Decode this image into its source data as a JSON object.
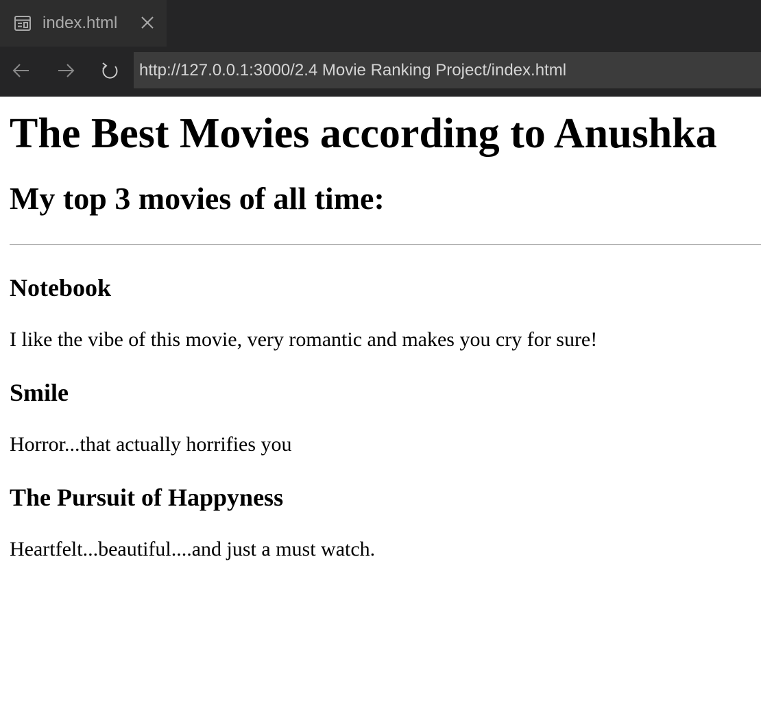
{
  "browser": {
    "tab": {
      "title": "index.html",
      "icon": "preview-icon",
      "close_icon": "close-icon"
    },
    "nav": {
      "back_icon": "back-arrow-icon",
      "forward_icon": "forward-arrow-icon",
      "reload_icon": "reload-icon",
      "url": "http://127.0.0.1:3000/2.4 Movie Ranking Project/index.html"
    },
    "colors": {
      "chrome_background": "#252526",
      "tab_background": "#2d2d2d",
      "url_background": "#3c3c3c"
    }
  },
  "page": {
    "title": "The Best Movies according to Anushka",
    "subtitle": "My top 3 movies of all time:",
    "movies": [
      {
        "title": "Notebook",
        "description": "I like the vibe of this movie, very romantic and makes you cry for sure!"
      },
      {
        "title": "Smile",
        "description": "Horror...that actually horrifies you"
      },
      {
        "title": "The Pursuit of Happyness",
        "description": "Heartfelt...beautiful....and just a must watch."
      }
    ]
  }
}
